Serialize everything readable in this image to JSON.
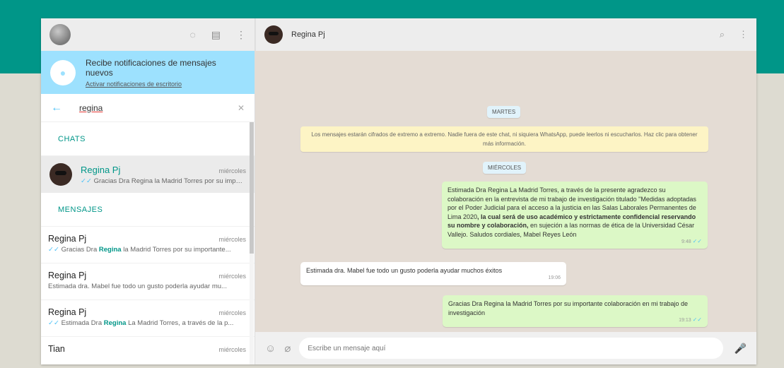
{
  "left_panel": {
    "notification": {
      "title": "Recibe notificaciones de mensajes nuevos",
      "link": "Activar notificaciones de escritorio"
    },
    "search": {
      "value": "regina"
    },
    "sections": {
      "chats": "CHATS",
      "messages": "MENSAJES"
    },
    "chat_result": {
      "name": "Regina Pj",
      "time": "miércoles",
      "preview": "Gracias Dra Regina la Madrid Torres por su importante colaboración..."
    },
    "message_results": [
      {
        "name": "Regina Pj",
        "time": "miércoles",
        "preview_before": "Gracias Dra ",
        "highlight": "Regina",
        "preview_after": " la Madrid Torres por su importante...",
        "tick": true
      },
      {
        "name": "Regina Pj",
        "time": "miércoles",
        "preview_before": "Estimada dra. Mabel fue todo un gusto poderla ayudar mu...",
        "highlight": "",
        "preview_after": "",
        "tick": false
      },
      {
        "name": "Regina Pj",
        "time": "miércoles",
        "preview_before": "Estimada Dra ",
        "highlight": "Regina",
        "preview_after": " La Madrid Torres, a través de la p...",
        "tick": true
      },
      {
        "name": "Tian",
        "time": "miércoles",
        "preview_before": "",
        "highlight": "",
        "preview_after": "",
        "tick": false
      }
    ]
  },
  "chat": {
    "contact_name": "Regina Pj",
    "date_chips": [
      "MARTES",
      "MIÉRCOLES"
    ],
    "system_message": "Los mensajes estarán cifrados de extremo a extremo. Nadie fuera de este chat, ni siquiera WhatsApp, puede leerlos ni escucharlos. Haz clic para obtener más información.",
    "messages": [
      {
        "direction": "out",
        "segments": [
          {
            "text": "Estimada Dra Regina La Madrid Torres, a través de la presente agradezco su colaboración en la entrevista de mi trabajo de investigación titulado \"Medidas adoptadas por el Poder Judicial para el acceso a la justicia en las Salas Laborales Permanentes de Lima 2020",
            "bold": false
          },
          {
            "text": ", la cual será de uso académico y estrictamente confidencial reservando su nombre y colaboración,",
            "bold": true
          },
          {
            "text": " en sujeción a las normas de ética de la Universidad César Vallejo. Saludos cordiales, Mabel Reyes León",
            "bold": false
          }
        ],
        "time": "9:48",
        "tick": "✓✓"
      },
      {
        "direction": "in",
        "segments": [
          {
            "text": "Estimada dra. Mabel fue todo un gusto poderla ayudar muchos éxitos",
            "bold": false
          }
        ],
        "time": "19:06",
        "tick": ""
      },
      {
        "direction": "out",
        "segments": [
          {
            "text": "Gracias Dra Regina la Madrid Torres por su importante colaboración en mi trabajo de investigación",
            "bold": false
          }
        ],
        "time": "19:13",
        "tick": "✓✓"
      }
    ],
    "composer_placeholder": "Escribe un mensaje aquí"
  },
  "icons": {
    "status": "status-icon",
    "new_chat": "new-chat-icon",
    "menu": "menu-icon",
    "bell": "bell-off-icon",
    "back": "back-arrow-icon",
    "clear": "close-icon",
    "search": "search-icon",
    "emoji": "emoji-icon",
    "attach": "paperclip-icon",
    "mic": "microphone-icon"
  },
  "colors": {
    "header_band": "#009688",
    "notification_bg": "#9de1fe",
    "outgoing_bubble": "#dcf8c6",
    "system_bubble": "#fdf4c5",
    "chat_background": "#e4dcd4",
    "accent": "#009688"
  }
}
